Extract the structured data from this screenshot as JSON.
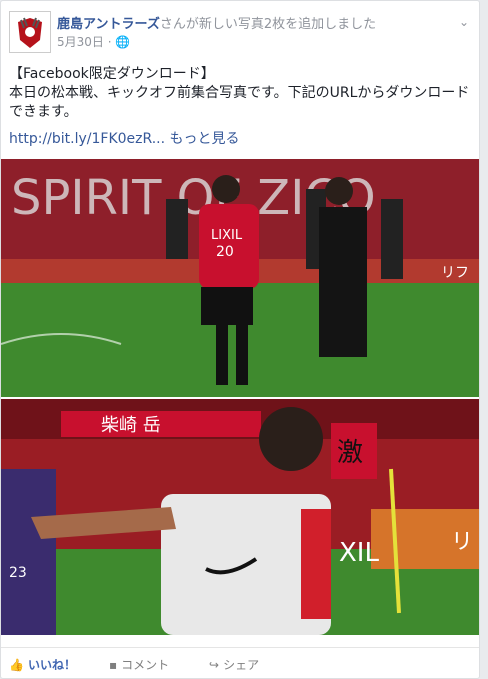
{
  "post": {
    "page_name": "鹿島アントラーズ",
    "action_text": "さんが新しい写真2枚を追加しました",
    "date": "5月30日",
    "privacy_icon": "globe-icon",
    "menu_icon": "chevron-down-icon",
    "text_line1": "【Facebook限定ダウンロード】",
    "text_line2": "本日の松本戦、キックオフ前集合写真です。下記のURLからダウンロードできます。",
    "link_text": "http://bit.ly/1FK0ezR...",
    "more_text": "もっと見る"
  },
  "photo1": {
    "banner_text": "SPIRIT OF ZICO",
    "shirt_sponsor": "LIXIL",
    "shirt_number": "20",
    "ad_board": "リフ"
  },
  "photo2": {
    "stand_text": "柴崎 岳",
    "flag_text": "激",
    "board_text": "XIL",
    "board_text2": "リ",
    "vest_number": "23"
  },
  "actions": {
    "like_label": "いいね！",
    "comment_label": "コメント",
    "share_label": "シェア"
  },
  "colors": {
    "brand_red": "#c8102e",
    "link_blue": "#365899",
    "like_blue": "#4267b2"
  }
}
